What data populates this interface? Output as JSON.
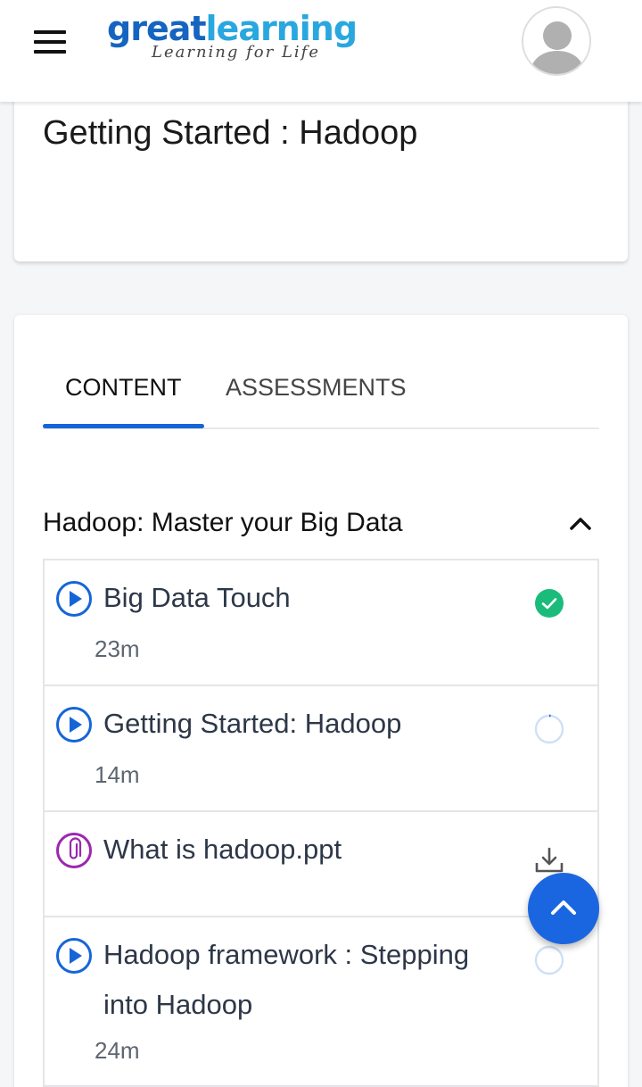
{
  "header": {
    "logo_primary": "great",
    "logo_secondary": "learning",
    "logo_tagline": "Learning for Life"
  },
  "page": {
    "title": "Getting Started : Hadoop"
  },
  "tabs": [
    {
      "label": "CONTENT",
      "active": true
    },
    {
      "label": "ASSESSMENTS",
      "active": false
    }
  ],
  "section": {
    "title": "Hadoop: Master your Big Data",
    "expanded": true
  },
  "items": [
    {
      "type": "video",
      "title": "Big Data Touch",
      "duration": "23m",
      "status": "completed"
    },
    {
      "type": "video",
      "title": "Getting Started: Hadoop",
      "duration": "14m",
      "status": "in-progress"
    },
    {
      "type": "attachment",
      "title": "What is hadoop.ppt",
      "duration": "",
      "status": "download"
    },
    {
      "type": "video",
      "title": "Hadoop framework : Stepping into Hadoop",
      "duration": "24m",
      "status": "not-started"
    }
  ],
  "colors": {
    "primary": "#1565d8",
    "success": "#1bbc7b",
    "attachment": "#9c27b0",
    "logo_dark": "#1565c0",
    "logo_light": "#29a7df"
  }
}
